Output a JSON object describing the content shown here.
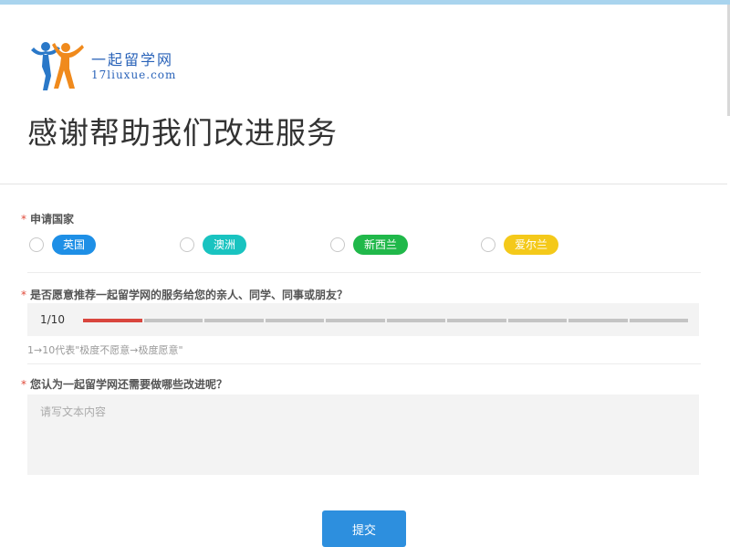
{
  "header": {
    "logo_cn": "一起留学网",
    "logo_en": "17liuxue.com",
    "title": "感谢帮助我们改进服务"
  },
  "q1": {
    "star": "*",
    "label": "申请国家",
    "options": [
      {
        "label": "英国",
        "color": "#1e8fe6"
      },
      {
        "label": "澳洲",
        "color": "#19c3c0"
      },
      {
        "label": "新西兰",
        "color": "#20b84a"
      },
      {
        "label": "爱尔兰",
        "color": "#f4c91a"
      }
    ]
  },
  "q2": {
    "star": "*",
    "label": "是否愿意推荐一起留学网的服务给您的亲人、同学、同事或朋友？",
    "value": "1/10",
    "rating": 1,
    "max": 10,
    "hint": "1→10代表\"极度不愿意→极度愿意\""
  },
  "q3": {
    "star": "*",
    "label": "您认为一起留学网还需要做哪些改进呢？",
    "placeholder": "请写文本内容"
  },
  "submit_label": "提交",
  "colors": {
    "accent": "#2d8fde",
    "rating_active": "#d9463e"
  }
}
